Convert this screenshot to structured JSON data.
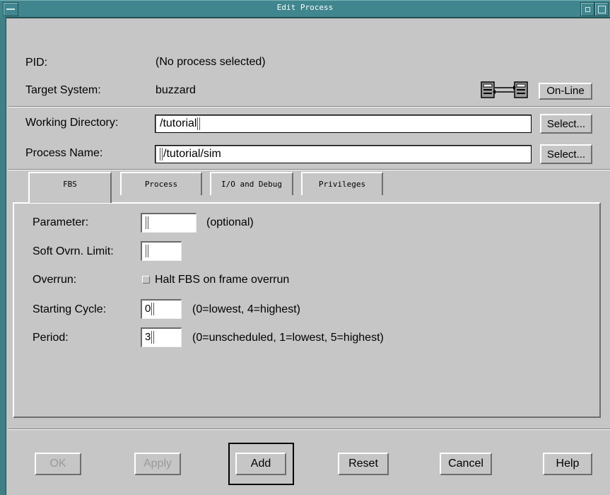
{
  "window": {
    "title": "Edit Process"
  },
  "header": {
    "pid_label": "PID:",
    "pid_value": "(No process selected)",
    "target_label": "Target System:",
    "target_value": "buzzard",
    "online_button": "On-Line",
    "connection_icon": "network-link-icon"
  },
  "fields": {
    "working_dir_label": "Working Directory:",
    "working_dir_value": "/tutorial",
    "working_dir_select": "Select...",
    "process_name_label": "Process Name:",
    "process_name_value": "/tutorial/sim",
    "process_name_select": "Select..."
  },
  "tabs": [
    {
      "label": "FBS",
      "active": true
    },
    {
      "label": "Process",
      "active": false
    },
    {
      "label": "I/O and Debug",
      "active": false
    },
    {
      "label": "Privileges",
      "active": false
    }
  ],
  "fbs": {
    "parameter_label": "Parameter:",
    "parameter_value": "",
    "parameter_hint": "(optional)",
    "soft_overrun_label": "Soft Ovrn. Limit:",
    "soft_overrun_value": "",
    "overrun_label": "Overrun:",
    "overrun_checkbox_label": "Halt FBS on frame overrun",
    "overrun_checked": false,
    "starting_cycle_label": "Starting Cycle:",
    "starting_cycle_value": "0",
    "starting_cycle_hint": "(0=lowest, 4=highest)",
    "period_label": "Period:",
    "period_value": "3",
    "period_hint": "(0=unscheduled, 1=lowest, 5=highest)"
  },
  "buttons": {
    "ok": "OK",
    "apply": "Apply",
    "add": "Add",
    "reset": "Reset",
    "cancel": "Cancel",
    "help": "Help"
  },
  "colors": {
    "window_bg": "#c6c6c6",
    "titlebar": "#3f868f"
  }
}
